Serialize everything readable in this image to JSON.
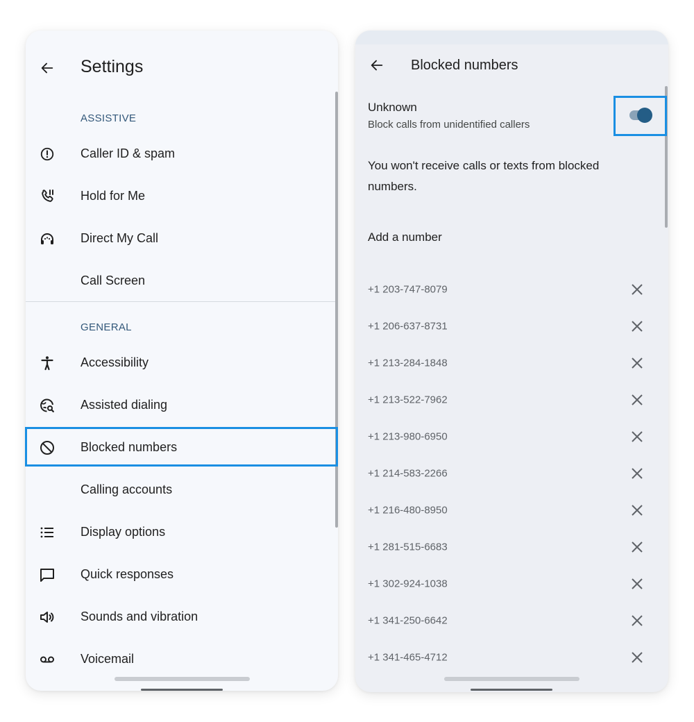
{
  "settings": {
    "title": "Settings",
    "sections": [
      {
        "label": "ASSISTIVE",
        "items": [
          {
            "label": "Caller ID & spam",
            "icon": "alert-circle-icon"
          },
          {
            "label": "Hold for Me",
            "icon": "phone-pause-icon"
          },
          {
            "label": "Direct My Call",
            "icon": "headset-icon"
          },
          {
            "label": "Call Screen",
            "icon": ""
          }
        ]
      },
      {
        "label": "GENERAL",
        "items": [
          {
            "label": "Accessibility",
            "icon": "accessibility-icon"
          },
          {
            "label": "Assisted dialing",
            "icon": "globe-search-icon"
          },
          {
            "label": "Blocked numbers",
            "icon": "block-icon"
          },
          {
            "label": "Calling accounts",
            "icon": ""
          },
          {
            "label": "Display options",
            "icon": "list-icon"
          },
          {
            "label": "Quick responses",
            "icon": "message-icon"
          },
          {
            "label": "Sounds and vibration",
            "icon": "volume-icon"
          },
          {
            "label": "Voicemail",
            "icon": "voicemail-icon"
          }
        ]
      }
    ]
  },
  "blocked": {
    "title": "Blocked numbers",
    "unknown_title": "Unknown",
    "unknown_subtitle": "Block calls from unidentified callers",
    "unknown_toggle_on": true,
    "info": "You won't receive calls or texts from blocked numbers.",
    "add_number": "Add a number",
    "numbers": [
      "+1 203-747-8079",
      "+1 206-637-8731",
      "+1 213-284-1848",
      "+1 213-522-7962",
      "+1 213-980-6950",
      "+1 214-583-2266",
      "+1 216-480-8950",
      "+1 281-515-6683",
      "+1 302-924-1038",
      "+1 341-250-6642",
      "+1 341-465-4712"
    ]
  },
  "colors": {
    "highlight": "#1a8fe3",
    "section_label": "#33587a",
    "toggle_thumb": "#245d86",
    "toggle_track": "#8aa3b8"
  }
}
